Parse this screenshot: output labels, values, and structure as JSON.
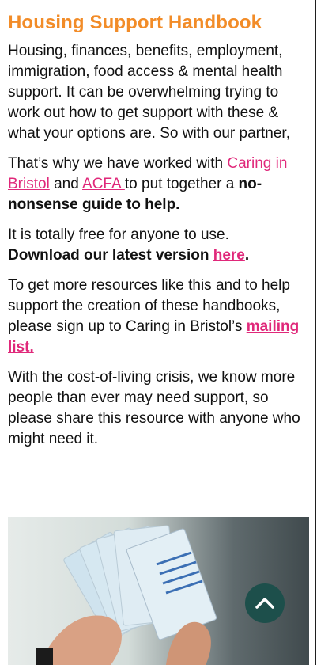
{
  "heading": "Housing Support Handbook",
  "para1": "Housing, finances, benefits, employment, immigration, food access & mental health support. It can be overwhelming trying to work out how to get support with these & what your options are. So with our partner,",
  "para2": {
    "prefix": "That’s why we have worked with ",
    "link1": "Caring in Bristol",
    "and": " and ",
    "link2": "ACFA ",
    "middle": " to put together a ",
    "bold": "no-nonsense guide to help."
  },
  "para3": {
    "line1": "It is totally free for anyone to use.",
    "bold": "Download our latest version ",
    "link": "here",
    "end": "."
  },
  "para4": {
    "text": "To get more resources like this and to help support the creation of these handbooks, please sign up to Caring in Bristol’s ",
    "link": "mailing list."
  },
  "para5": "With the cost-of-living crisis, we know more people than ever may need support, so please share this resource with anyone who might need it.",
  "photo_icon": "handbook-photo",
  "scroll_button": {
    "icon": "chevron-up-icon",
    "color": "#1d4f4b"
  },
  "colors": {
    "heading": "#f28c28",
    "link": "#e0287a"
  }
}
